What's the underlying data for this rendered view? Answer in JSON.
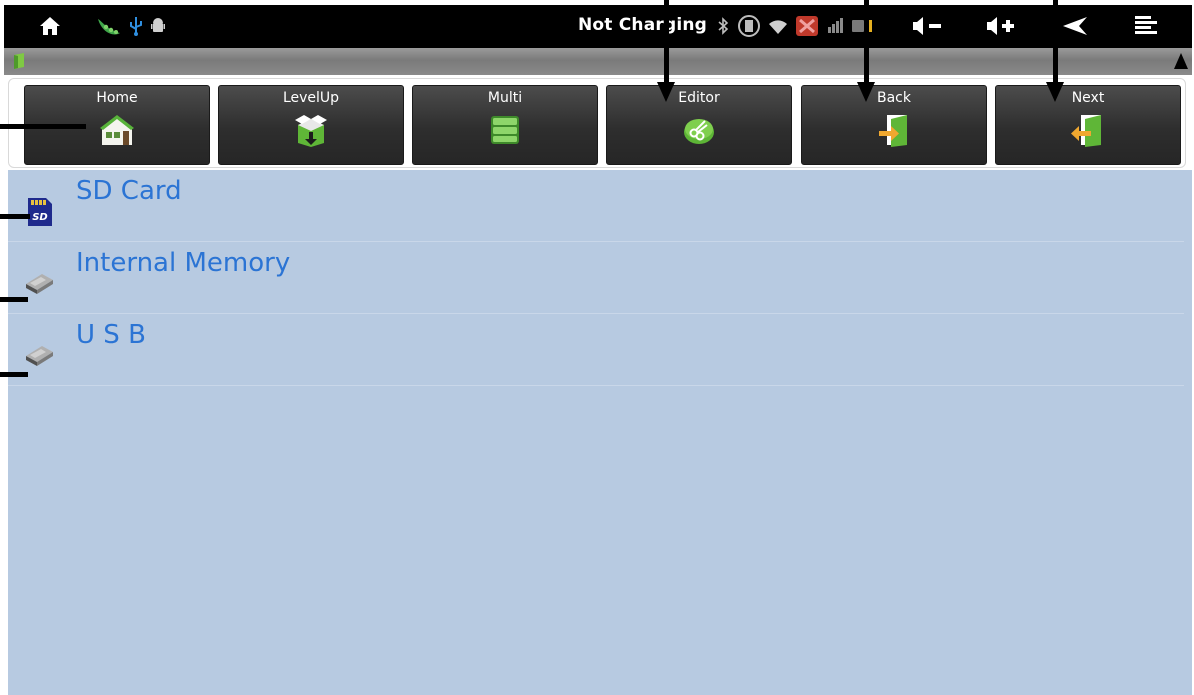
{
  "status_bar": {
    "charging_status": "Not Charging",
    "icons": [
      "home-icon",
      "pea-pod-icon",
      "usb-icon",
      "android-debug-icon",
      "bluetooth-icon",
      "screen-rotate-icon",
      "wifi-icon",
      "no-signal-icon",
      "signal-bars-icon",
      "battery-icon",
      "volume-down-icon",
      "volume-up-icon",
      "back-arrow-icon",
      "menu-icon"
    ]
  },
  "toolbar": {
    "buttons": [
      {
        "label": "Home",
        "icon": "house-icon"
      },
      {
        "label": "LevelUp",
        "icon": "box-up-icon"
      },
      {
        "label": "Multi",
        "icon": "multi-list-icon"
      },
      {
        "label": "Editor",
        "icon": "scissors-icon"
      },
      {
        "label": "Back",
        "icon": "door-back-icon"
      },
      {
        "label": "Next",
        "icon": "door-next-icon"
      }
    ]
  },
  "storage_list": {
    "items": [
      {
        "label": "SD Card",
        "icon": "sd-card-icon"
      },
      {
        "label": "Internal Memory",
        "icon": "drive-icon"
      },
      {
        "label": "U S B",
        "icon": "drive-icon"
      }
    ]
  },
  "colors": {
    "list_background": "#b7cae1",
    "item_text": "#2b74d4",
    "status_bar": "#000000",
    "button_gradient_top": "#4c4c4c",
    "button_gradient_bottom": "#262626"
  }
}
